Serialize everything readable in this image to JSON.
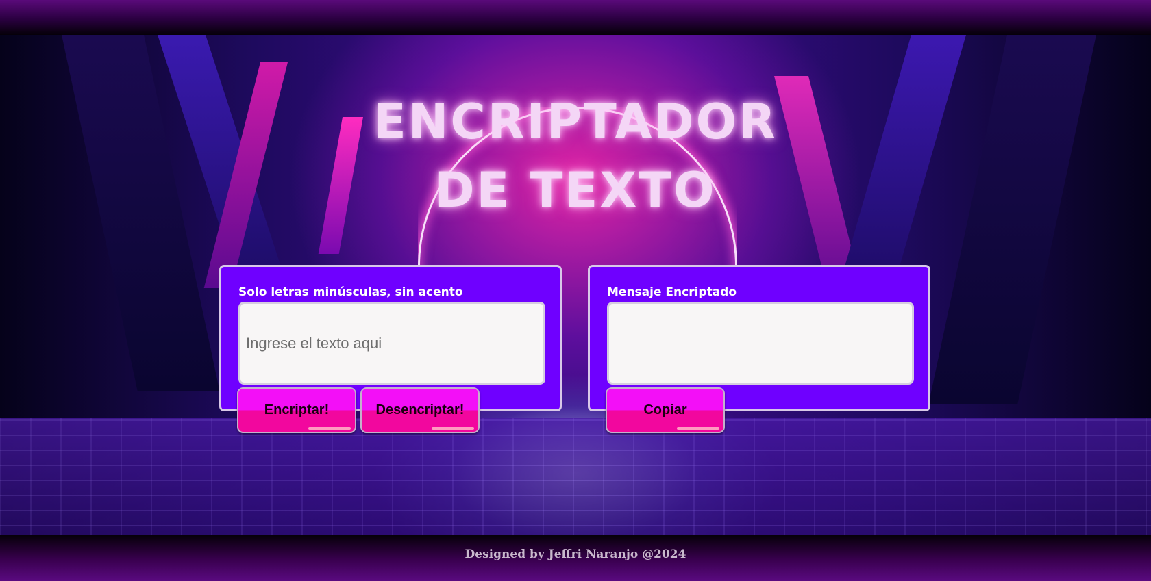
{
  "header": {
    "title_line1": "ENCRIPTADOR",
    "title_line2": "DE TEXTO"
  },
  "input_panel": {
    "label": "Solo letras minúsculas, sin acento",
    "placeholder": "Ingrese el texto aqui",
    "value": "",
    "encrypt_button": "Encriptar!",
    "decrypt_button": "Desencriptar!"
  },
  "output_panel": {
    "label": "Mensaje Encriptado",
    "value": "",
    "copy_button": "Copiar"
  },
  "footer": {
    "text": "Designed by Jeffri Naranjo @2024"
  },
  "colors": {
    "panel": "#6f00ff",
    "button_top": "#f30ff7",
    "button_bottom": "#f2079e",
    "title_glow": "#f4d6f6"
  }
}
